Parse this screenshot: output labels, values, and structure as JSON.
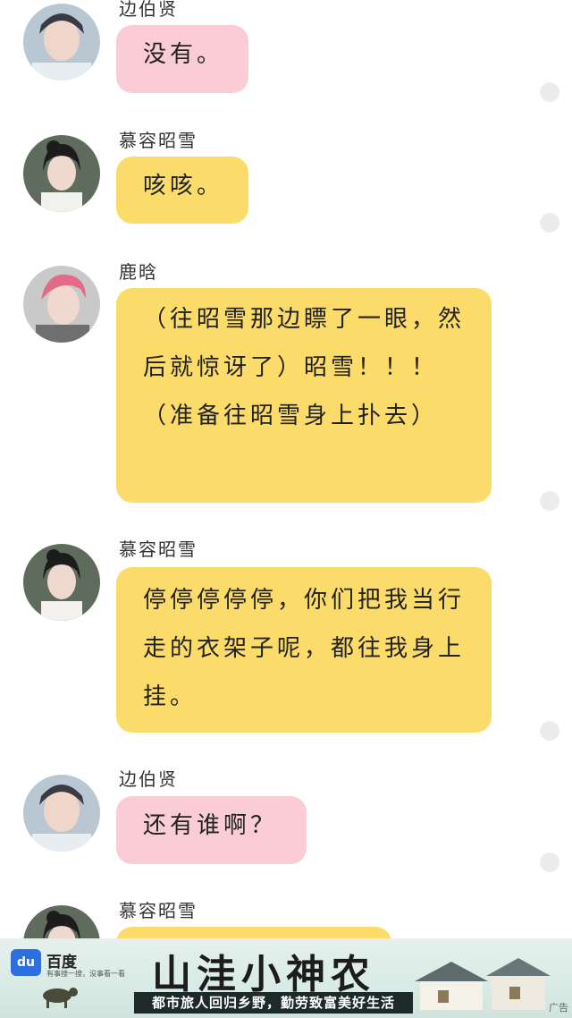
{
  "messages": [
    {
      "sender": "边伯贤",
      "text": "没有。",
      "bubble": "pink"
    },
    {
      "sender": "慕容昭雪",
      "text": "咳咳。",
      "bubble": "yellow"
    },
    {
      "sender": "鹿晗",
      "text": "（往昭雪那边瞟了一眼，然后就惊讶了）昭雪！！！（准备往昭雪身上扑去）",
      "bubble": "yellow"
    },
    {
      "sender": "慕容昭雪",
      "text": "停停停停停，你们把我当行走的衣架子呢，都往我身上挂。",
      "bubble": "yellow"
    },
    {
      "sender": "边伯贤",
      "text": "还有谁啊？",
      "bubble": "pink"
    },
    {
      "sender": "慕容昭雪",
      "text": "",
      "bubble": "yellow"
    }
  ],
  "ad": {
    "brand": "百度",
    "brand_icon": "du",
    "slogan": "有事搜一搜，没事看一看",
    "title": "山洼小神农",
    "subtitle": "都市旅人回归乡野，勤劳致富美好生活",
    "mark": "广告"
  },
  "colors": {
    "pink_bubble": "#f9ccd6",
    "yellow_bubble": "#fbdc6a"
  }
}
